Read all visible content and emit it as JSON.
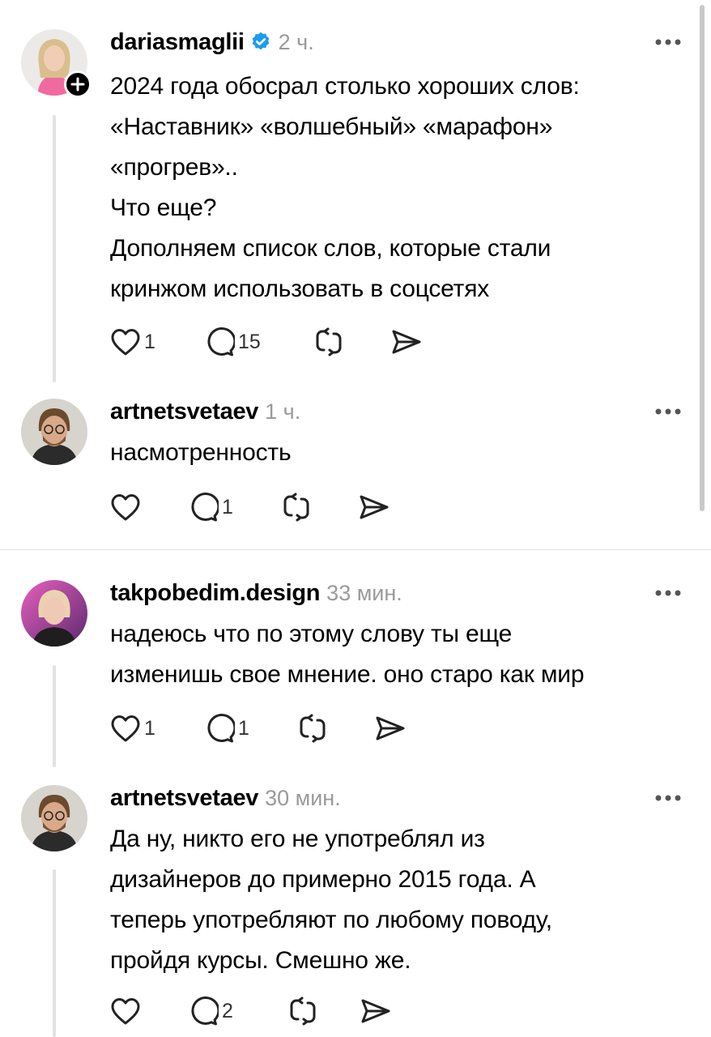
{
  "posts": [
    {
      "username": "dariasmaglii",
      "verified": true,
      "time": "2 ч.",
      "lines": [
        "2024 года обосрал столько хороших слов:",
        "«Наставник» «волшебный» «марафон»",
        "«прогрев»..",
        "Что еще?",
        "Дополняем список слов, которые стали",
        "кринжом использовать в соцсетях"
      ],
      "likes": "1",
      "comments": "15",
      "avatar": "woman-blonde-pink-avatar"
    },
    {
      "username": "artnetsvetaev",
      "time": "1 ч.",
      "lines": [
        "насмотренность"
      ],
      "likes": "",
      "comments": "1",
      "avatar": "man-glasses-beard-avatar"
    },
    {
      "username": "takpobedim.design",
      "time": "33 мин.",
      "lines": [
        "надеюсь что по этому слову ты еще",
        "изменишь свое мнение. оно старо как мир"
      ],
      "likes": "1",
      "comments": "1",
      "avatar": "woman-neon-light-avatar"
    },
    {
      "username": "artnetsvetaev",
      "time": "30 мин.",
      "lines": [
        "Да ну, никто его не употреблял из",
        "дизайнеров до примерно 2015 года. А",
        "теперь употребляют по любому поводу,",
        "пройдя курсы. Смешно же."
      ],
      "likes": "",
      "comments": "2",
      "avatar": "man-glasses-beard-avatar"
    }
  ],
  "colors": {
    "text": "#000000",
    "muted": "#9a9a9a",
    "verified": "#1d9bf0",
    "thread_line": "#e2e2e2",
    "separator": "#e0e0e0"
  },
  "icons": [
    "plus-icon",
    "verified-icon",
    "more-icon",
    "heart-icon",
    "comment-icon",
    "repost-icon",
    "share-icon"
  ]
}
